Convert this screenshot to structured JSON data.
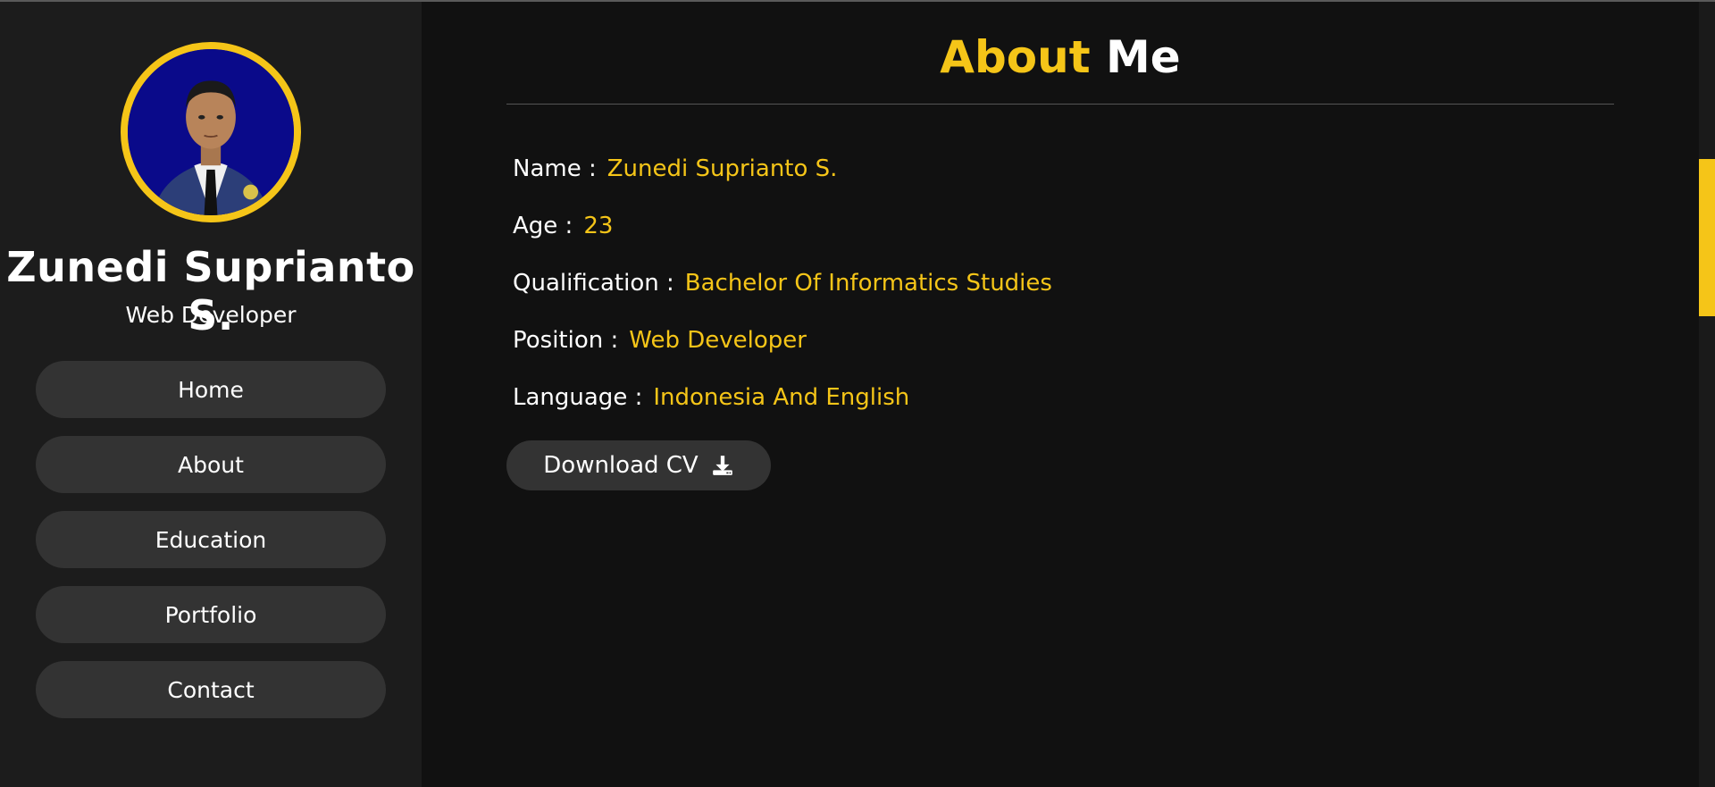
{
  "sidebar": {
    "name": "Zunedi Suprianto S.",
    "role": "Web Developer",
    "nav": [
      {
        "label": "Home"
      },
      {
        "label": "About"
      },
      {
        "label": "Education"
      },
      {
        "label": "Portfolio"
      },
      {
        "label": "Contact"
      }
    ]
  },
  "main": {
    "title_accent": "About",
    "title_rest": "Me",
    "info": [
      {
        "label": "Name :",
        "value": "Zunedi Suprianto S."
      },
      {
        "label": "Age :",
        "value": "23"
      },
      {
        "label": "Qualification :",
        "value": "Bachelor Of Informatics Studies"
      },
      {
        "label": "Position :",
        "value": "Web Developer"
      },
      {
        "label": "Language :",
        "value": "Indonesia And English"
      }
    ],
    "download_label": "Download CV",
    "download_icon": "download-icon"
  },
  "colors": {
    "accent": "#f5c518",
    "sidebar_bg": "#1c1c1c",
    "main_bg": "#111111",
    "button_bg": "#333333"
  }
}
